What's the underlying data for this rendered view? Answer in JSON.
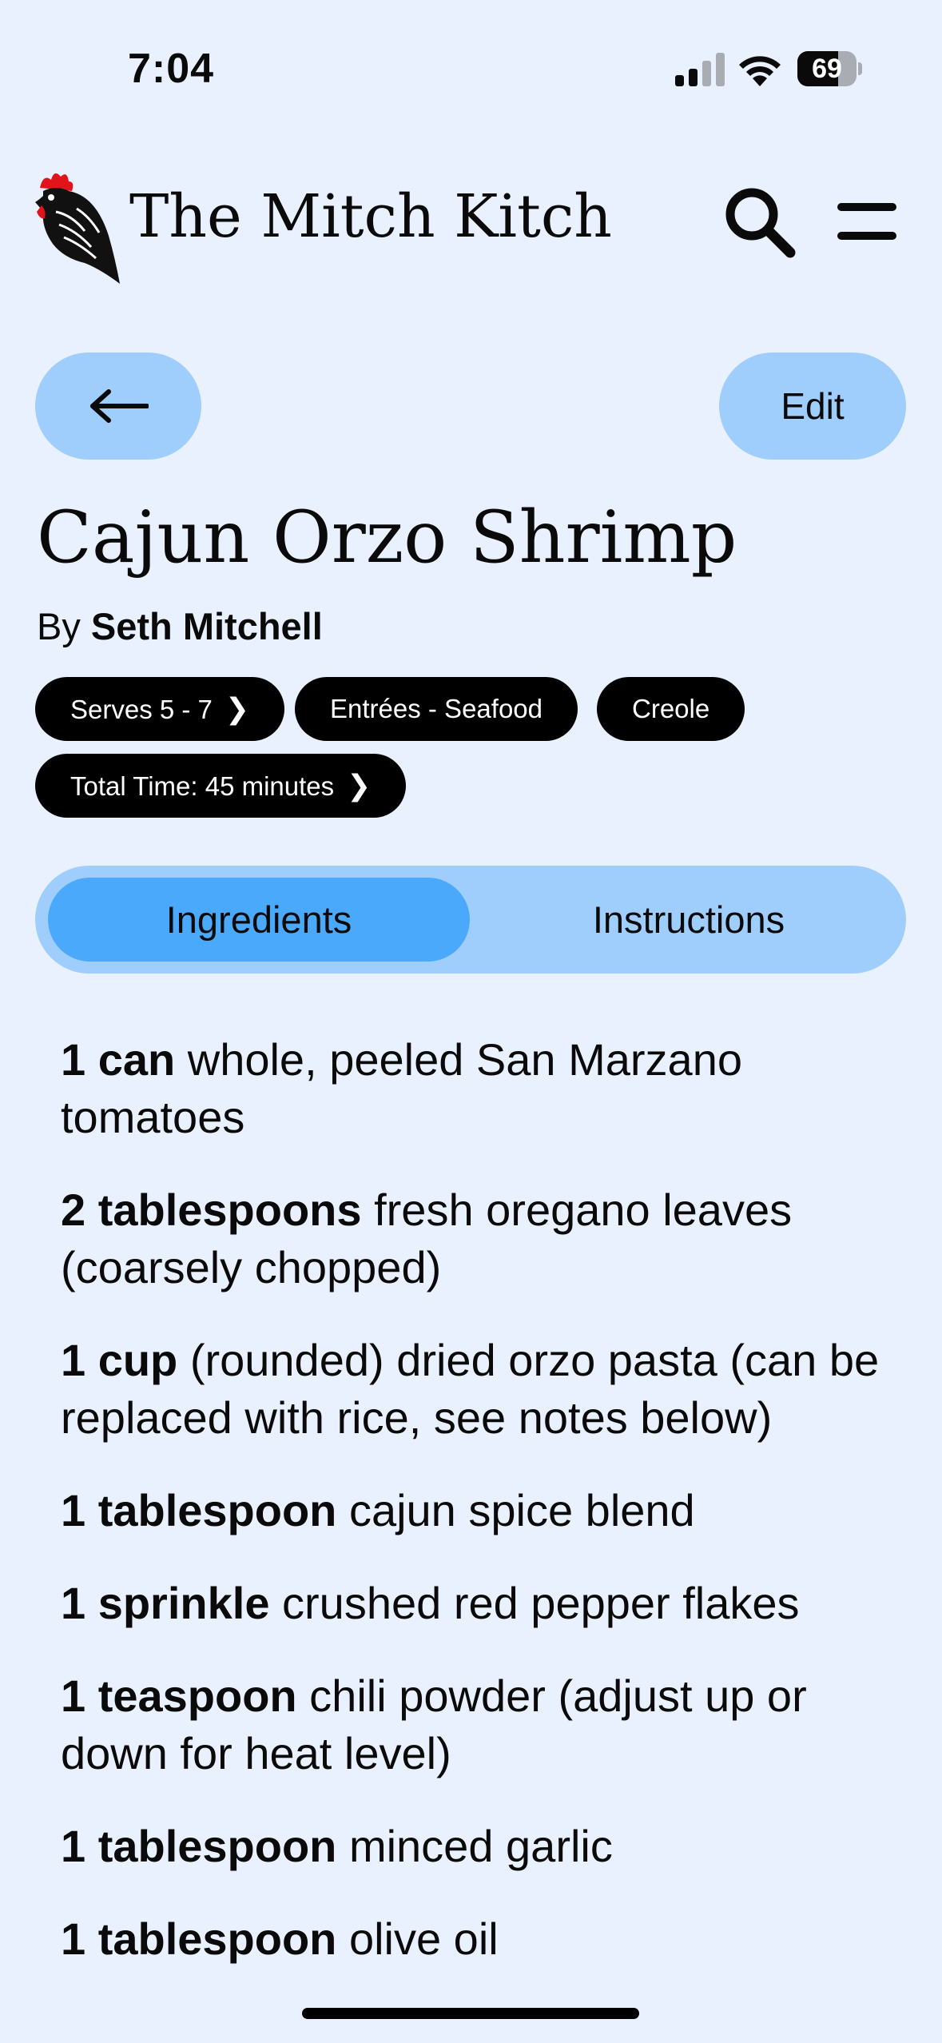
{
  "status_bar": {
    "time": "7:04",
    "battery_percent": 69,
    "battery_label": "69"
  },
  "header": {
    "site_title": "The Mitch Kitch",
    "logo_icon": "rooster-logo-icon",
    "search_icon": "search-icon",
    "menu_icon": "hamburger-menu-icon"
  },
  "nav": {
    "back_icon": "arrow-left-icon",
    "edit_label": "Edit"
  },
  "recipe": {
    "title": "Cajun Orzo Shrimp",
    "by_prefix": "By",
    "author": "Seth Mitchell",
    "tags": [
      {
        "label": "Serves 5 - 7",
        "has_chevron": true
      },
      {
        "label": "Entrées - Seafood",
        "has_chevron": false
      },
      {
        "label": "Creole",
        "has_chevron": false
      },
      {
        "label": "Total Time: 45 minutes",
        "has_chevron": true
      }
    ]
  },
  "tabs": {
    "ingredients": "Ingredients",
    "instructions": "Instructions",
    "active": "Ingredients"
  },
  "ingredients": [
    {
      "amount": "1 can",
      "text": " whole, peeled San Marzano tomatoes"
    },
    {
      "amount": "2 tablespoons",
      "text": " fresh oregano leaves (coarsely chopped)"
    },
    {
      "amount": "1 cup",
      "text": " (rounded) dried orzo pasta (can be replaced with rice, see notes below)"
    },
    {
      "amount": "1 tablespoon",
      "text": " cajun spice blend"
    },
    {
      "amount": "1 sprinkle",
      "text": " crushed red pepper flakes"
    },
    {
      "amount": "1 teaspoon",
      "text": " chili powder (adjust up or down for heat level)"
    },
    {
      "amount": "1 tablespoon",
      "text": " minced garlic"
    },
    {
      "amount": "1 tablespoon",
      "text": " olive oil"
    }
  ],
  "colors": {
    "background": "#eaf1fe",
    "button_light_blue": "#9fcdfc",
    "tab_active_blue": "#4ba9fb",
    "tag_black": "#000000",
    "rooster_red": "#e0141a"
  }
}
